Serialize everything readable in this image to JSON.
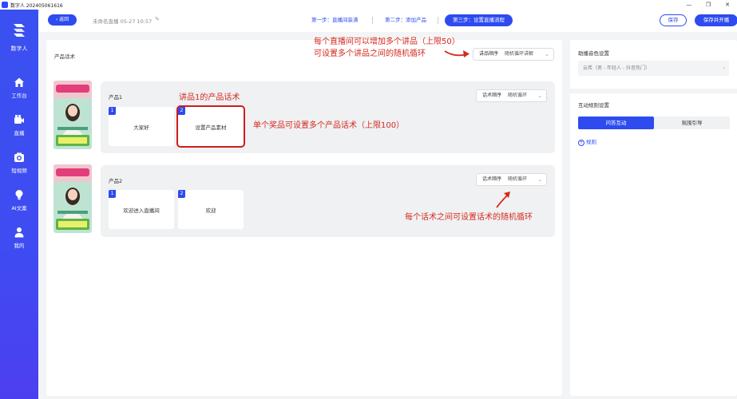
{
  "window": {
    "title": "数字人 202405061616",
    "buttons": [
      "—",
      "❐",
      "✕"
    ]
  },
  "sidebar": {
    "logo_text": "数字人",
    "items": [
      {
        "label": "工作台",
        "icon": "home-icon"
      },
      {
        "label": "直播",
        "icon": "camera-icon"
      },
      {
        "label": "短视频",
        "icon": "video-camera-icon"
      },
      {
        "label": "AI文案",
        "icon": "lightbulb-icon"
      },
      {
        "label": "我的",
        "icon": "user-icon"
      }
    ]
  },
  "topbar": {
    "back_label": "返回",
    "live_title": "未命名直播 05-27 10:57",
    "steps": [
      {
        "label": "第一步：直播间装潢"
      },
      {
        "label": "第二步：添加产品"
      },
      {
        "label": "第三步：设置直播流程"
      }
    ],
    "save_label": "保存",
    "save_start_label": "保存并开播"
  },
  "center": {
    "section_title": "产品话术",
    "global_order": {
      "label": "讲品顺序",
      "value": "随机循环讲解"
    },
    "products": [
      {
        "name": "产品1",
        "order": {
          "label": "话术顺序",
          "value": "随机循环"
        },
        "materials": [
          {
            "num": "1",
            "text": "大家好"
          },
          {
            "num": "2",
            "text": "设置产品素材"
          }
        ]
      },
      {
        "name": "产品2",
        "order": {
          "label": "话术顺序",
          "value": "随机循环"
        },
        "materials": [
          {
            "num": "1",
            "text": "欢迎进入直播间"
          },
          {
            "num": "2",
            "text": "欢迎"
          }
        ]
      }
    ]
  },
  "annotations": {
    "top_line1": "每个直播间可以增加多个讲品（上限50）",
    "top_line2": "可设置多个讲品之间的随机循环",
    "product_script": "讲品1的产品话术",
    "materials_limit": "单个奖品可设置多个产品话术（上限100）",
    "random_loop": "每个话术之间可设置话术的随机循环"
  },
  "right": {
    "voice_title": "助播音色设置",
    "voice_value": "云希（男 - 年轻人 - 抖音热门）",
    "interaction_title": "互动规则设置",
    "tabs": [
      {
        "label": "问答互动"
      },
      {
        "label": "氛围引导"
      }
    ],
    "rules_link": "规则"
  },
  "colors": {
    "accent": "#2e4bf0",
    "annotation_red": "#d42a1f"
  }
}
